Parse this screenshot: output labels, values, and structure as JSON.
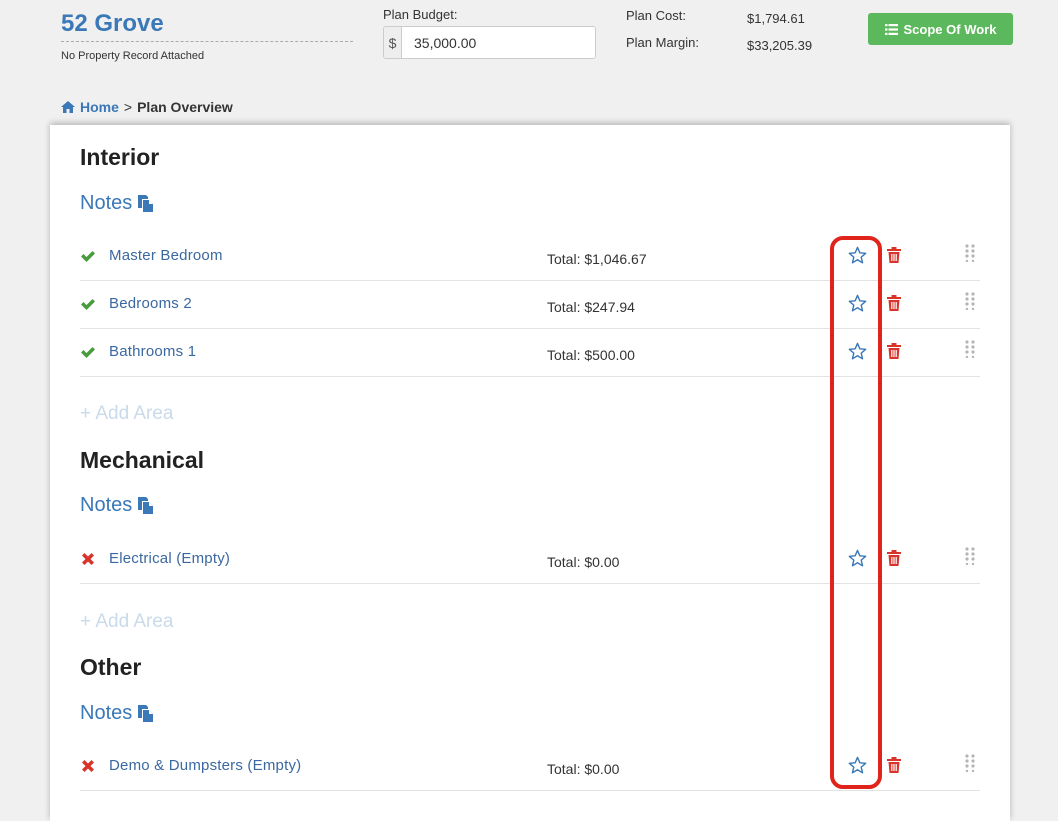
{
  "property": {
    "title": "52 Grove",
    "subtitle": "No Property Record Attached"
  },
  "budget": {
    "label": "Plan Budget:",
    "currency": "$",
    "value": "35,000.00"
  },
  "plan": {
    "cost_label": "Plan Cost:",
    "cost_value": "$1,794.61",
    "margin_label": "Plan Margin:",
    "margin_value": "$33,205.39"
  },
  "scope_button": {
    "label": "Scope Of Work",
    "icon": "list-icon",
    "color": "#5cb85c"
  },
  "breadcrumb": {
    "home_icon": "home-icon",
    "home": "Home",
    "separator": ">",
    "current": "Plan Overview"
  },
  "sections": [
    {
      "title": "Interior",
      "notes": "Notes",
      "add_area": "+ Add Area",
      "areas": [
        {
          "name": "Master Bedroom",
          "total": "Total: $1,046.67",
          "status": "check-icon"
        },
        {
          "name": "Bedrooms 2",
          "total": "Total: $247.94",
          "status": "check-icon"
        },
        {
          "name": "Bathrooms 1",
          "total": "Total: $500.00",
          "status": "check-icon"
        }
      ]
    },
    {
      "title": "Mechanical",
      "notes": "Notes",
      "add_area": "+ Add Area",
      "areas": [
        {
          "name": "Electrical (Empty)",
          "total": "Total: $0.00",
          "status": "x-icon"
        }
      ]
    },
    {
      "title": "Other",
      "notes": "Notes",
      "areas": [
        {
          "name": "Demo & Dumpsters (Empty)",
          "total": "Total: $0.00",
          "status": "x-icon"
        }
      ]
    }
  ],
  "colors": {
    "link": "#3a78b8",
    "check": "#4a9a3e",
    "remove": "#d9342b",
    "highlight": "#e0231b"
  }
}
